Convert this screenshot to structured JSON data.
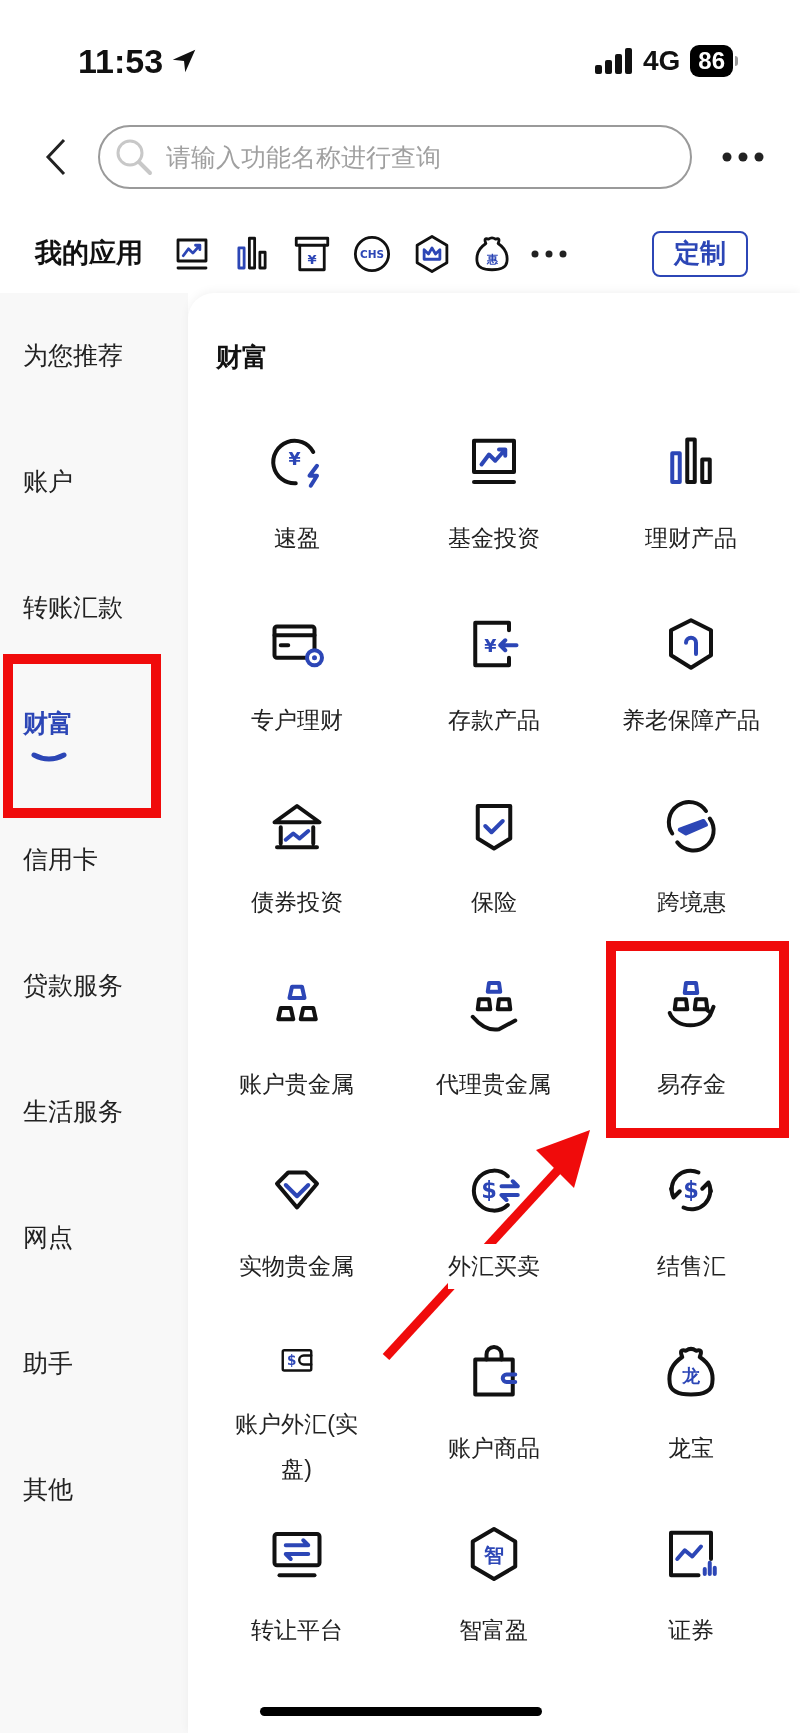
{
  "status_bar": {
    "time": "11:53",
    "network": "4G",
    "battery": "86"
  },
  "search": {
    "placeholder": "请输入功能名称进行查询"
  },
  "my_apps": {
    "title": "我的应用",
    "icon_glyphs": [
      "¥",
      "CHS",
      "惠"
    ],
    "button": "定制"
  },
  "sidebar": {
    "items": [
      {
        "label": "为您推荐",
        "selected": false
      },
      {
        "label": "账户",
        "selected": false
      },
      {
        "label": "转账汇款",
        "selected": false
      },
      {
        "label": "财富",
        "selected": true
      },
      {
        "label": "信用卡",
        "selected": false
      },
      {
        "label": "贷款服务",
        "selected": false
      },
      {
        "label": "生活服务",
        "selected": false
      },
      {
        "label": "网点",
        "selected": false
      },
      {
        "label": "助手",
        "selected": false
      },
      {
        "label": "其他",
        "selected": false
      }
    ]
  },
  "section": {
    "title": "财富",
    "apps": [
      {
        "label": "速盈",
        "glyph": "¥"
      },
      {
        "label": "基金投资"
      },
      {
        "label": "理财产品"
      },
      {
        "label": "专户理财"
      },
      {
        "label": "存款产品",
        "glyph": "¥"
      },
      {
        "label": "养老保障产品"
      },
      {
        "label": "债券投资"
      },
      {
        "label": "保险"
      },
      {
        "label": "跨境惠"
      },
      {
        "label": "账户贵金属"
      },
      {
        "label": "代理贵金属"
      },
      {
        "label": "易存金"
      },
      {
        "label": "实物贵金属"
      },
      {
        "label": "外汇买卖",
        "glyph": "$"
      },
      {
        "label": "结售汇",
        "glyph": "$"
      },
      {
        "label": "账户外汇(实盘)",
        "glyph": "$"
      },
      {
        "label": "账户商品"
      },
      {
        "label": "龙宝",
        "glyph": "龙"
      },
      {
        "label": "转让平台"
      },
      {
        "label": "智富盈",
        "glyph": "智"
      },
      {
        "label": "证券"
      }
    ]
  }
}
